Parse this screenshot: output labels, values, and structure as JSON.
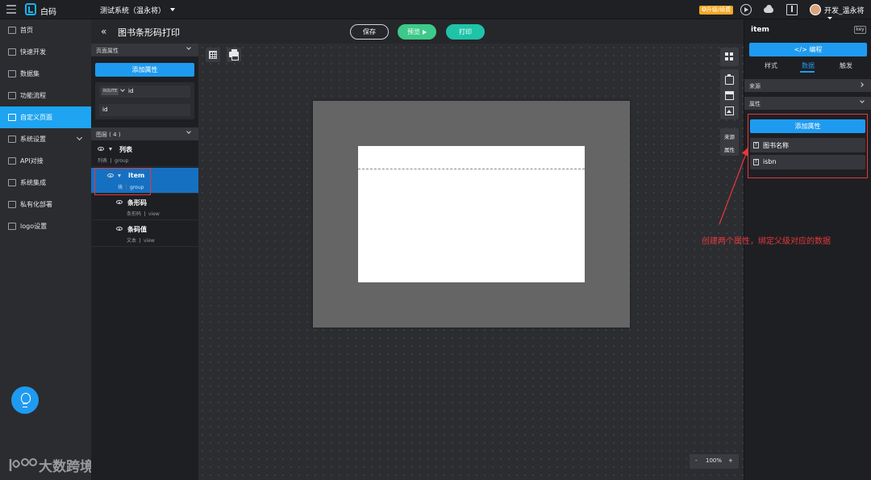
{
  "topbar": {
    "app_name": "白码",
    "system_name": "测试系统（温永将）",
    "upgrade_badge": "✪升级/续费",
    "user_name": "开发_温永将"
  },
  "nav": {
    "items": [
      {
        "label": "首页",
        "icon": "home-icon"
      },
      {
        "label": "快速开发",
        "icon": "cube-icon"
      },
      {
        "label": "数据集",
        "icon": "database-icon"
      },
      {
        "label": "功能流程",
        "icon": "flow-icon"
      },
      {
        "label": "自定义页面",
        "icon": "page-icon",
        "active": true
      },
      {
        "label": "系统设置",
        "icon": "settings-icon",
        "expandable": true
      },
      {
        "label": "API对接",
        "icon": "api-icon"
      },
      {
        "label": "系统集成",
        "icon": "integration-icon"
      },
      {
        "label": "私有化部署",
        "icon": "server-icon"
      },
      {
        "label": "logo设置",
        "icon": "logo-icon"
      }
    ],
    "watermark": "大数跨境"
  },
  "header": {
    "back": "«",
    "title": "图书条形码打印",
    "save": "保存",
    "preview": "预览",
    "print": "打印"
  },
  "left_panel": {
    "page_props_title": "页面属性",
    "add_attr": "添加属性",
    "param": {
      "source_tag": "ROUTE",
      "key": "id",
      "value": "id"
    },
    "layers_title": "图层 ( 4 )",
    "layers": [
      {
        "name": "列表",
        "type_cn": "列表",
        "type": "group"
      },
      {
        "name": "item",
        "type_cn": "块",
        "type": "group",
        "selected": true
      },
      {
        "name": "条形码",
        "type_cn": "条形码",
        "type": "view"
      },
      {
        "name": "条码值",
        "type_cn": "文本",
        "type": "view"
      }
    ]
  },
  "canvas": {
    "zoom": "100%",
    "zoom_minus": "-",
    "zoom_plus": "+",
    "side_source": "来源",
    "side_attr": "属性"
  },
  "right_panel": {
    "title": "item",
    "key_tag": "key",
    "code_button": "</> 编程",
    "tabs": [
      "样式",
      "数据",
      "触发"
    ],
    "active_tab": "数据",
    "source_section": "来源",
    "attr_section": "属性",
    "add_attr": "添加属性",
    "attrs": [
      {
        "label": "图书名称"
      },
      {
        "label": "isbn"
      }
    ]
  },
  "annotation": "创建两个属性，绑定父级对应的数据",
  "colors": {
    "accent": "#1e9bf0",
    "active_nav": "#1ea4f0",
    "preview": "#3dc98a",
    "print": "#1fc3a7",
    "highlight": "#e4393c",
    "upgrade": "#f5a623"
  }
}
